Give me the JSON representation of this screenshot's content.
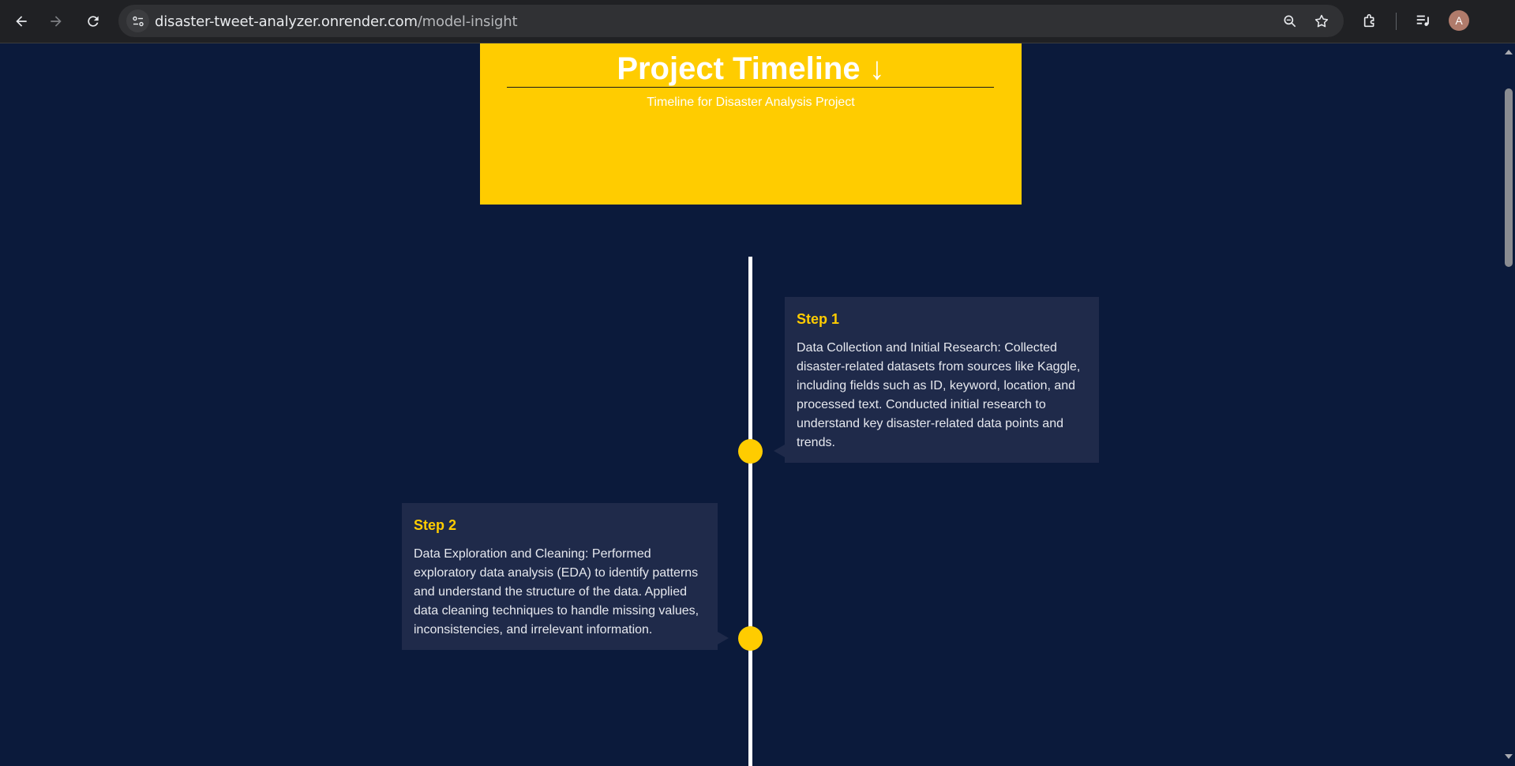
{
  "browser": {
    "url_host": "disaster-tweet-analyzer.onrender.com",
    "url_path": "/model-insight",
    "profile_initial": "A"
  },
  "header": {
    "title": "Project Timeline ↓",
    "subtitle": "Timeline for Disaster Analysis Project"
  },
  "steps": [
    {
      "title": "Step 1",
      "text": "Data Collection and Initial Research: Collected disaster-related datasets from sources like Kaggle, including fields such as ID, keyword, location, and processed text. Conducted initial research to understand key disaster-related data points and trends."
    },
    {
      "title": "Step 2",
      "text": "Data Exploration and Cleaning: Performed exploratory data analysis (EDA) to identify patterns and understand the structure of the data. Applied data cleaning techniques to handle missing values, inconsistencies, and irrelevant information."
    }
  ],
  "colors": {
    "background": "#0b1a3b",
    "accent": "#ffcc00",
    "card": "#1f2a4a",
    "timeline": "#ffffff"
  }
}
